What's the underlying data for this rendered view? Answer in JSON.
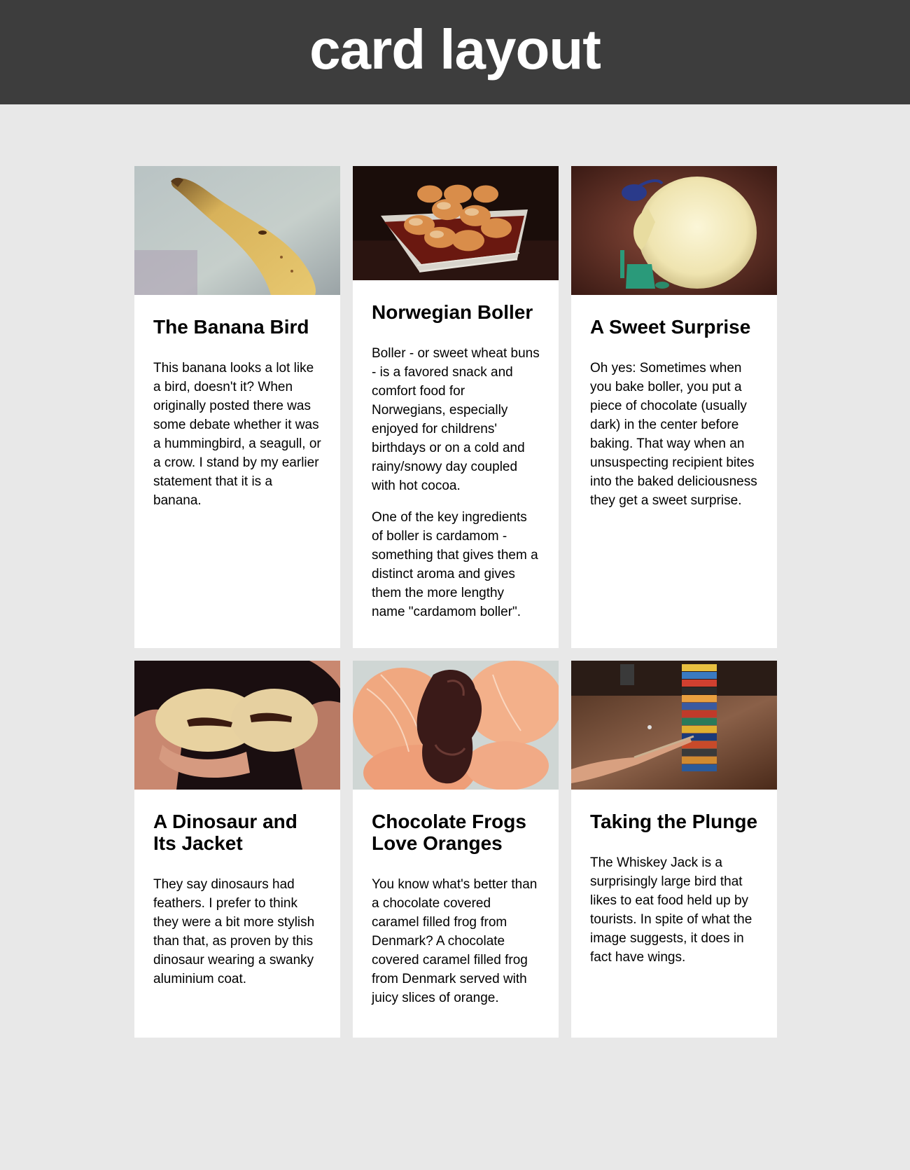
{
  "page": {
    "title": "card layout"
  },
  "colors": {
    "header_bg": "#3d3d3d",
    "page_bg": "#e8e8e8",
    "card_bg": "#ffffff"
  },
  "cards": [
    {
      "image": "banana-photo",
      "title": "The Banana Bird",
      "paragraphs": [
        "This banana looks a lot like a bird, doesn't it? When originally posted there was some debate whether it was a hummingbird, a seagull, or a crow. I stand by my earlier statement that it is a banana."
      ]
    },
    {
      "image": "boller-basket-photo",
      "title": "Norwegian Boller",
      "paragraphs": [
        "Boller - or sweet wheat buns - is a favored snack and comfort food for Norwegians, especially enjoyed for childrens' birthdays or on a cold and rainy/snowy day coupled with hot cocoa.",
        "One of the key ingredients of boller is cardamom - something that gives them a distinct aroma and gives them the more lengthy name \"cardamom boller\"."
      ]
    },
    {
      "image": "dinosaur-foil-photo",
      "title": "A Sweet Surprise",
      "paragraphs": [
        "Oh yes: Sometimes when you bake boller, you put a piece of chocolate (usually dark) in the center before baking. That way when an unsuspecting recipient bites into the baked deliciousness they get a sweet surprise."
      ]
    },
    {
      "image": "boller-chocolate-halves-photo",
      "title": "A Dinosaur and Its Jacket",
      "paragraphs": [
        "They say dinosaurs had feathers. I prefer to think they were a bit more stylish than that, as proven by this dinosaur wearing a swanky aluminium coat."
      ]
    },
    {
      "image": "chocolate-frog-orange-photo",
      "title": "Chocolate Frogs Love Oranges",
      "paragraphs": [
        "You know what's better than a chocolate covered caramel filled frog from Denmark? A chocolate covered caramel filled frog from Denmark served with juicy slices of orange."
      ]
    },
    {
      "image": "jenga-tower-photo",
      "title": "Taking the Plunge",
      "paragraphs": [
        "The Whiskey Jack is a surprisingly large bird that likes to eat food held up by tourists. In spite of what the image suggests, it does in fact have wings."
      ]
    }
  ]
}
